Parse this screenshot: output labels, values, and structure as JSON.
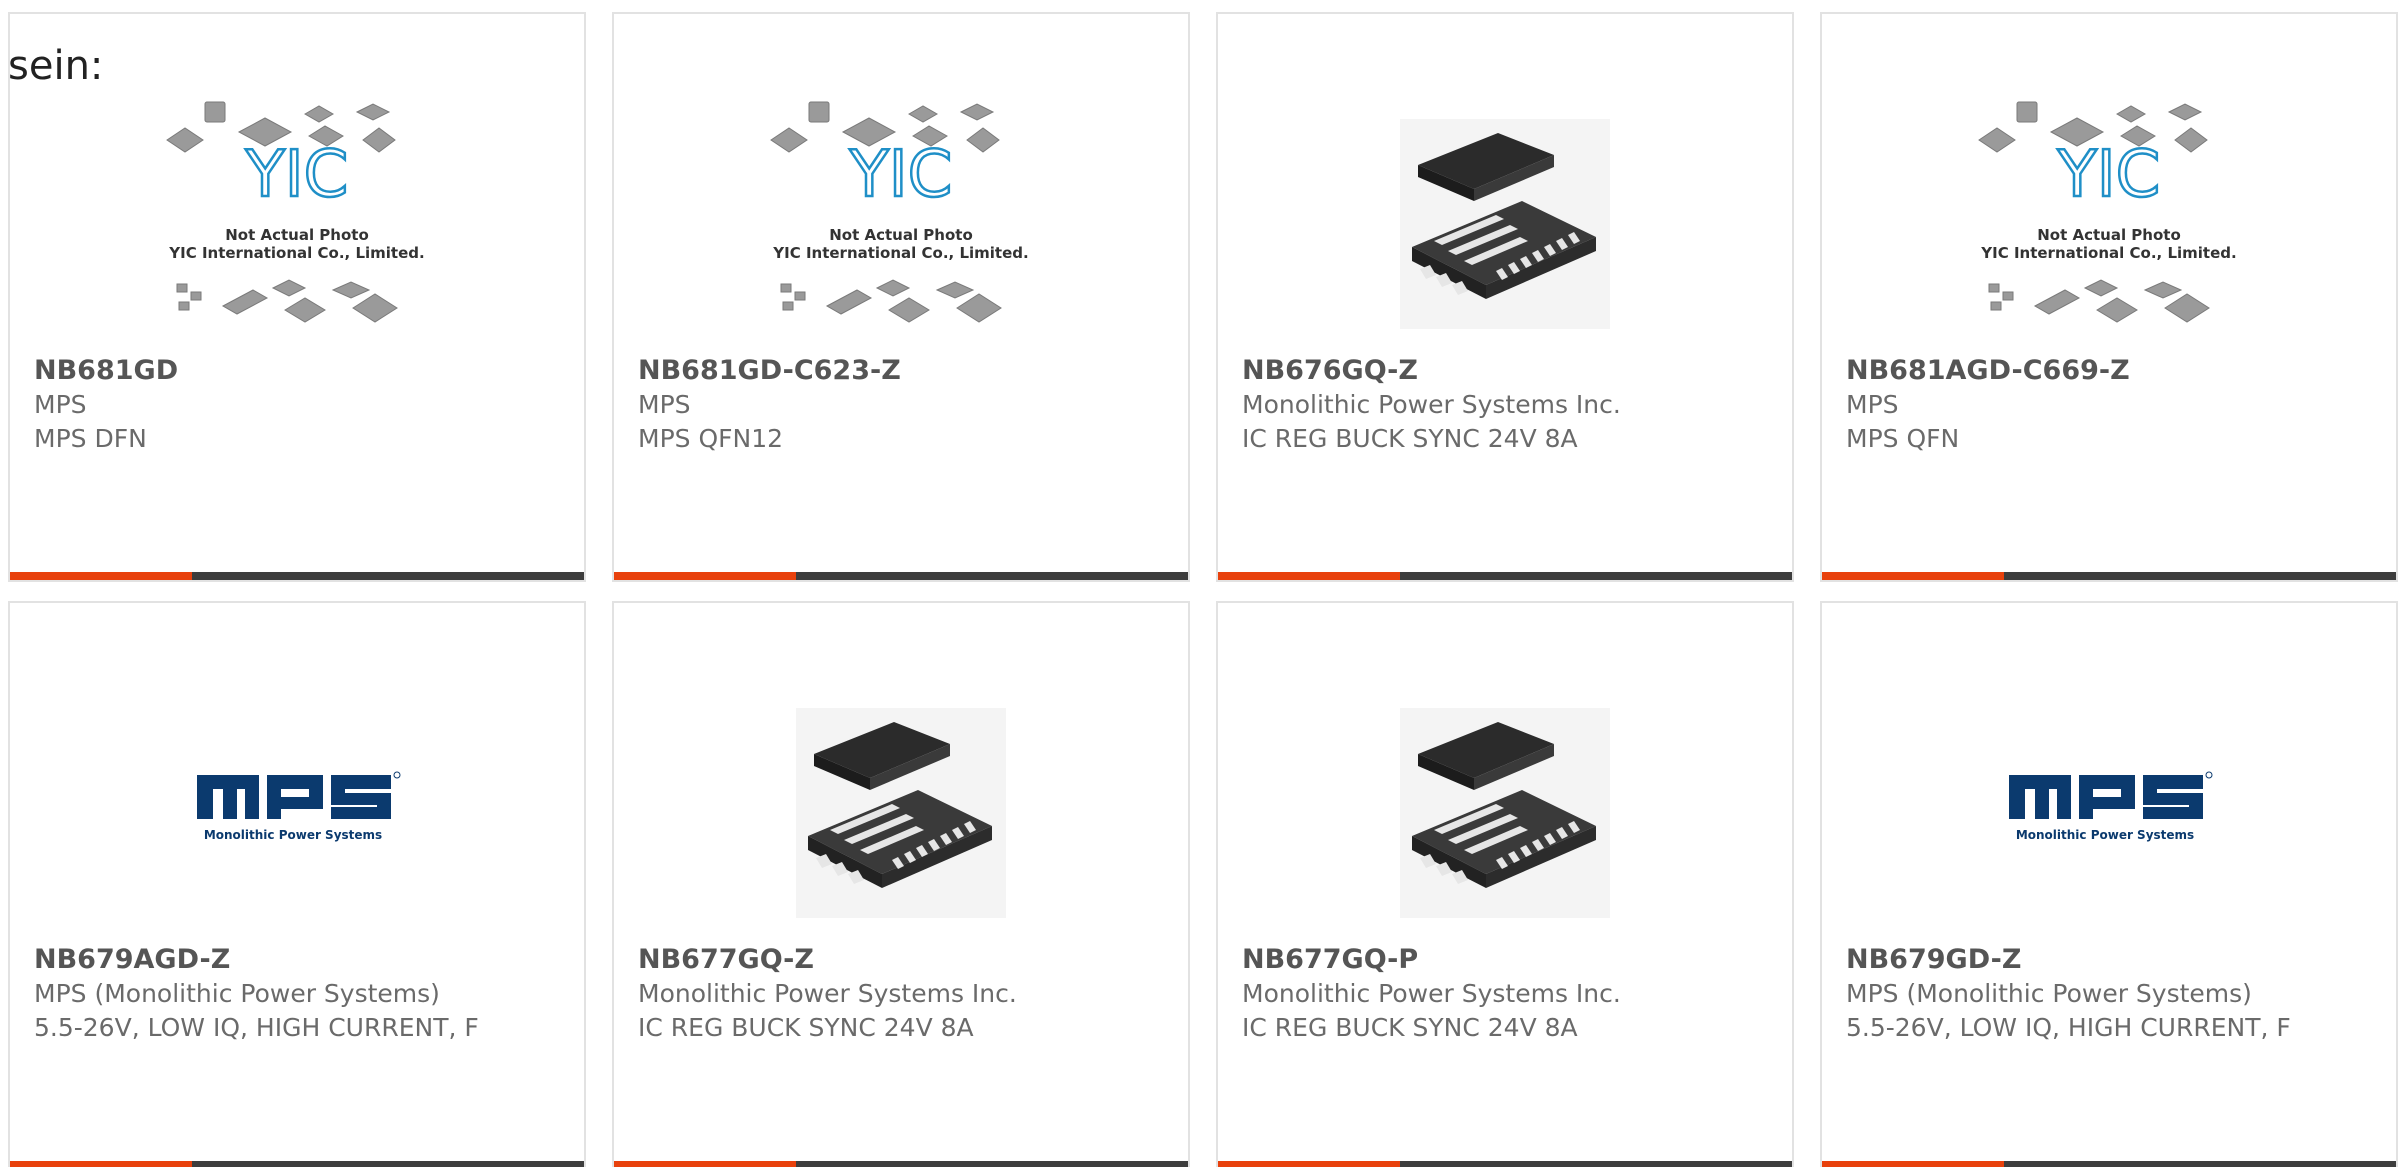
{
  "intro": {
    "text": "sein:"
  },
  "placeholder": {
    "line1": "Not Actual Photo",
    "line2": "YIC International Co., Limited."
  },
  "brand_logo": {
    "tagline": "Monolithic Power Systems"
  },
  "colors": {
    "accent": "#e8410c",
    "bar": "#3d3d3d",
    "border": "#e2e2e2",
    "mps_logo": "#0b3a6e",
    "yic_logo": "#1f8fc7"
  },
  "products": [
    {
      "part": "NB681GD",
      "manufacturer": "MPS",
      "description": "MPS DFN",
      "image": "yic-placeholder-photo"
    },
    {
      "part": "NB681GD-C623-Z",
      "manufacturer": "MPS",
      "description": "MPS QFN12",
      "image": "yic-placeholder-photo"
    },
    {
      "part": "NB676GQ-Z",
      "manufacturer": "Monolithic Power Systems Inc.",
      "description": "IC REG BUCK SYNC 24V 8A",
      "image": "qfn-chip-photo"
    },
    {
      "part": "NB681AGD-C669-Z",
      "manufacturer": "MPS",
      "description": "MPS QFN",
      "image": "yic-placeholder-photo"
    },
    {
      "part": "NB679AGD-Z",
      "manufacturer": "MPS (Monolithic Power Systems)",
      "description": "5.5-26V, LOW IQ, HIGH CURRENT, F",
      "image": "mps-logo"
    },
    {
      "part": "NB677GQ-Z",
      "manufacturer": "Monolithic Power Systems Inc.",
      "description": "IC REG BUCK SYNC 24V 8A",
      "image": "qfn-chip-photo"
    },
    {
      "part": "NB677GQ-P",
      "manufacturer": "Monolithic Power Systems Inc.",
      "description": "IC REG BUCK SYNC 24V 8A",
      "image": "qfn-chip-photo"
    },
    {
      "part": "NB679GD-Z",
      "manufacturer": "MPS (Monolithic Power Systems)",
      "description": "5.5-26V, LOW IQ, HIGH CURRENT, F",
      "image": "mps-logo"
    }
  ]
}
